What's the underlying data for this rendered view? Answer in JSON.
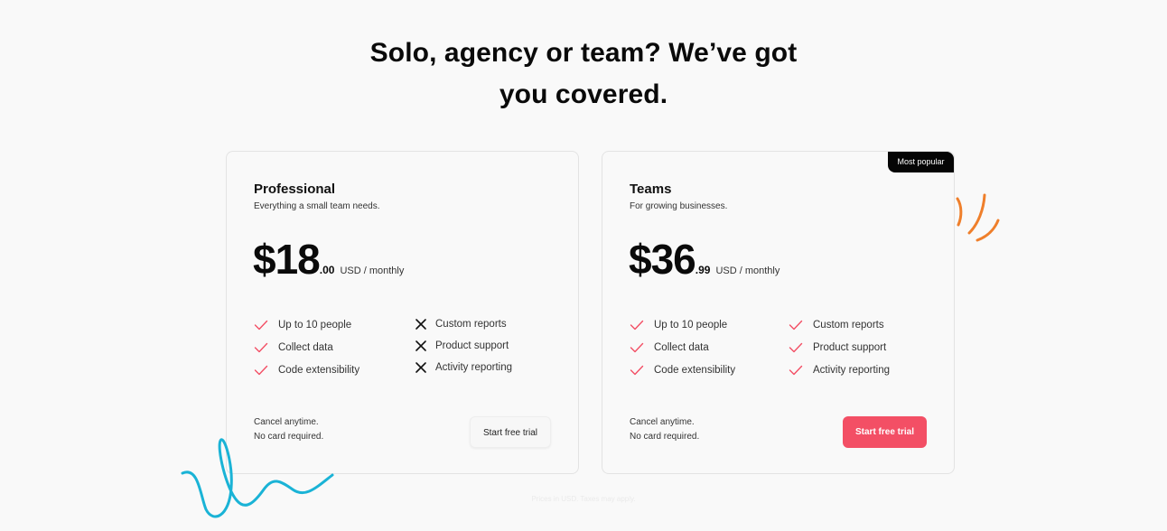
{
  "heading": {
    "line1": "Solo, agency or team? We’ve got",
    "line2": "you covered."
  },
  "colors": {
    "accent": "#f34f65",
    "check": "#f34f65",
    "badge": "#050505",
    "doodle_orange": "#ef7f2b",
    "doodle_blue": "#1ab3d6"
  },
  "plans": [
    {
      "name": "Professional",
      "description": "Everything a small team needs.",
      "price_whole": "$18",
      "price_cents": ".00",
      "price_period": "USD / monthly",
      "features_left": [
        {
          "label": "Up to 10 people",
          "icon": "check-icon"
        },
        {
          "label": "Collect data",
          "icon": "check-icon"
        },
        {
          "label": "Code extensibility",
          "icon": "check-icon"
        }
      ],
      "features_right": [
        {
          "label": "Custom reports",
          "icon": "x-icon"
        },
        {
          "label": "Product support",
          "icon": "x-icon"
        },
        {
          "label": "Activity reporting",
          "icon": "x-icon"
        }
      ],
      "note_line1": "Cancel anytime.",
      "note_line2": "No card required.",
      "cta": "Start free trial"
    },
    {
      "name": "Teams",
      "description": "For growing businesses.",
      "badge": "Most popular",
      "price_whole": "$36",
      "price_cents": ".99",
      "price_period": "USD / monthly",
      "features_left": [
        {
          "label": "Up to 10 people",
          "icon": "check-icon"
        },
        {
          "label": "Collect data",
          "icon": "check-icon"
        },
        {
          "label": "Code extensibility",
          "icon": "check-icon"
        }
      ],
      "features_right": [
        {
          "label": "Custom reports",
          "icon": "check-icon"
        },
        {
          "label": "Product support",
          "icon": "check-icon"
        },
        {
          "label": "Activity reporting",
          "icon": "check-icon"
        }
      ],
      "note_line1": "Cancel anytime.",
      "note_line2": "No card required.",
      "cta": "Start free trial"
    }
  ],
  "footnote": "Prices in USD. Taxes may apply."
}
